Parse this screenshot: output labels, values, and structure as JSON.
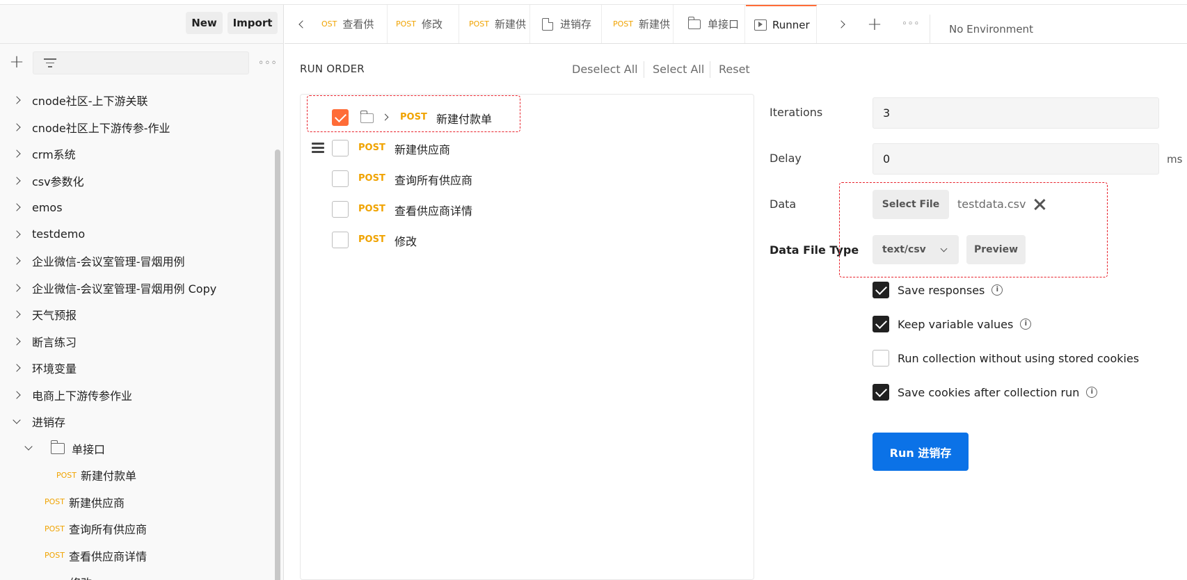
{
  "sidebar": {
    "new_label": "New",
    "import_label": "Import",
    "tree": [
      {
        "label": "cnode社区-上下游关联",
        "depth": 0,
        "expanded": false
      },
      {
        "label": "cnode社区上下游传参-作业",
        "depth": 0,
        "expanded": false
      },
      {
        "label": "crm系统",
        "depth": 0,
        "expanded": false
      },
      {
        "label": "csv参数化",
        "depth": 0,
        "expanded": false
      },
      {
        "label": "emos",
        "depth": 0,
        "expanded": false
      },
      {
        "label": "testdemo",
        "depth": 0,
        "expanded": false
      },
      {
        "label": "企业微信-会议室管理-冒烟用例",
        "depth": 0,
        "expanded": false
      },
      {
        "label": "企业微信-会议室管理-冒烟用例 Copy",
        "depth": 0,
        "expanded": false
      },
      {
        "label": "天气预报",
        "depth": 0,
        "expanded": false
      },
      {
        "label": "断言练习",
        "depth": 0,
        "expanded": false
      },
      {
        "label": "环境变量",
        "depth": 0,
        "expanded": false
      },
      {
        "label": "电商上下游传参作业",
        "depth": 0,
        "expanded": false
      },
      {
        "label": "进销存",
        "depth": 0,
        "expanded": true
      }
    ],
    "folder": {
      "label": "单接口"
    },
    "requests": [
      {
        "method": "POST",
        "label": "新建付款单"
      },
      {
        "method": "POST",
        "label": "新建供应商"
      },
      {
        "method": "POST",
        "label": "查询所有供应商"
      },
      {
        "method": "POST",
        "label": "查看供应商详情"
      },
      {
        "method": "",
        "label": "修改"
      }
    ]
  },
  "tabs": [
    {
      "method": "OST",
      "label": "查看供"
    },
    {
      "method": "POST",
      "label": "修改"
    },
    {
      "method": "POST",
      "label": "新建供"
    },
    {
      "method": "",
      "label": "进销存"
    },
    {
      "method": "POST",
      "label": "新建供"
    },
    {
      "method": "",
      "label": "单接口"
    },
    {
      "method": "",
      "label": "Runner"
    }
  ],
  "environment": "No Environment",
  "run_order": {
    "title": "RUN ORDER",
    "deselect_all": "Deselect All",
    "select_all": "Select All",
    "reset": "Reset",
    "items": [
      {
        "method": "POST",
        "label": "新建付款单",
        "checked": true
      },
      {
        "method": "POST",
        "label": "新建供应商",
        "checked": false
      },
      {
        "method": "POST",
        "label": "查询所有供应商",
        "checked": false
      },
      {
        "method": "POST",
        "label": "查看供应商详情",
        "checked": false
      },
      {
        "method": "POST",
        "label": "修改",
        "checked": false
      }
    ]
  },
  "settings": {
    "iterations_label": "Iterations",
    "iterations_value": "3",
    "delay_label": "Delay",
    "delay_value": "0",
    "delay_unit": "ms",
    "data_label": "Data",
    "select_file": "Select File",
    "file_name": "testdata.csv",
    "data_file_type_label": "Data File Type",
    "data_file_type_value": "text/csv",
    "preview": "Preview",
    "options": [
      {
        "label": "Save responses",
        "checked": true,
        "info": true
      },
      {
        "label": "Keep variable values",
        "checked": true,
        "info": true
      },
      {
        "label": "Run collection without using stored cookies",
        "checked": false,
        "info": false
      },
      {
        "label": "Save cookies after collection run",
        "checked": true,
        "info": true
      }
    ],
    "run_button": "Run 进销存"
  },
  "colors": {
    "accent": "#ff6c37",
    "run_button": "#0b72e7",
    "post": "#f0a300",
    "annotation": "#e8202a"
  }
}
